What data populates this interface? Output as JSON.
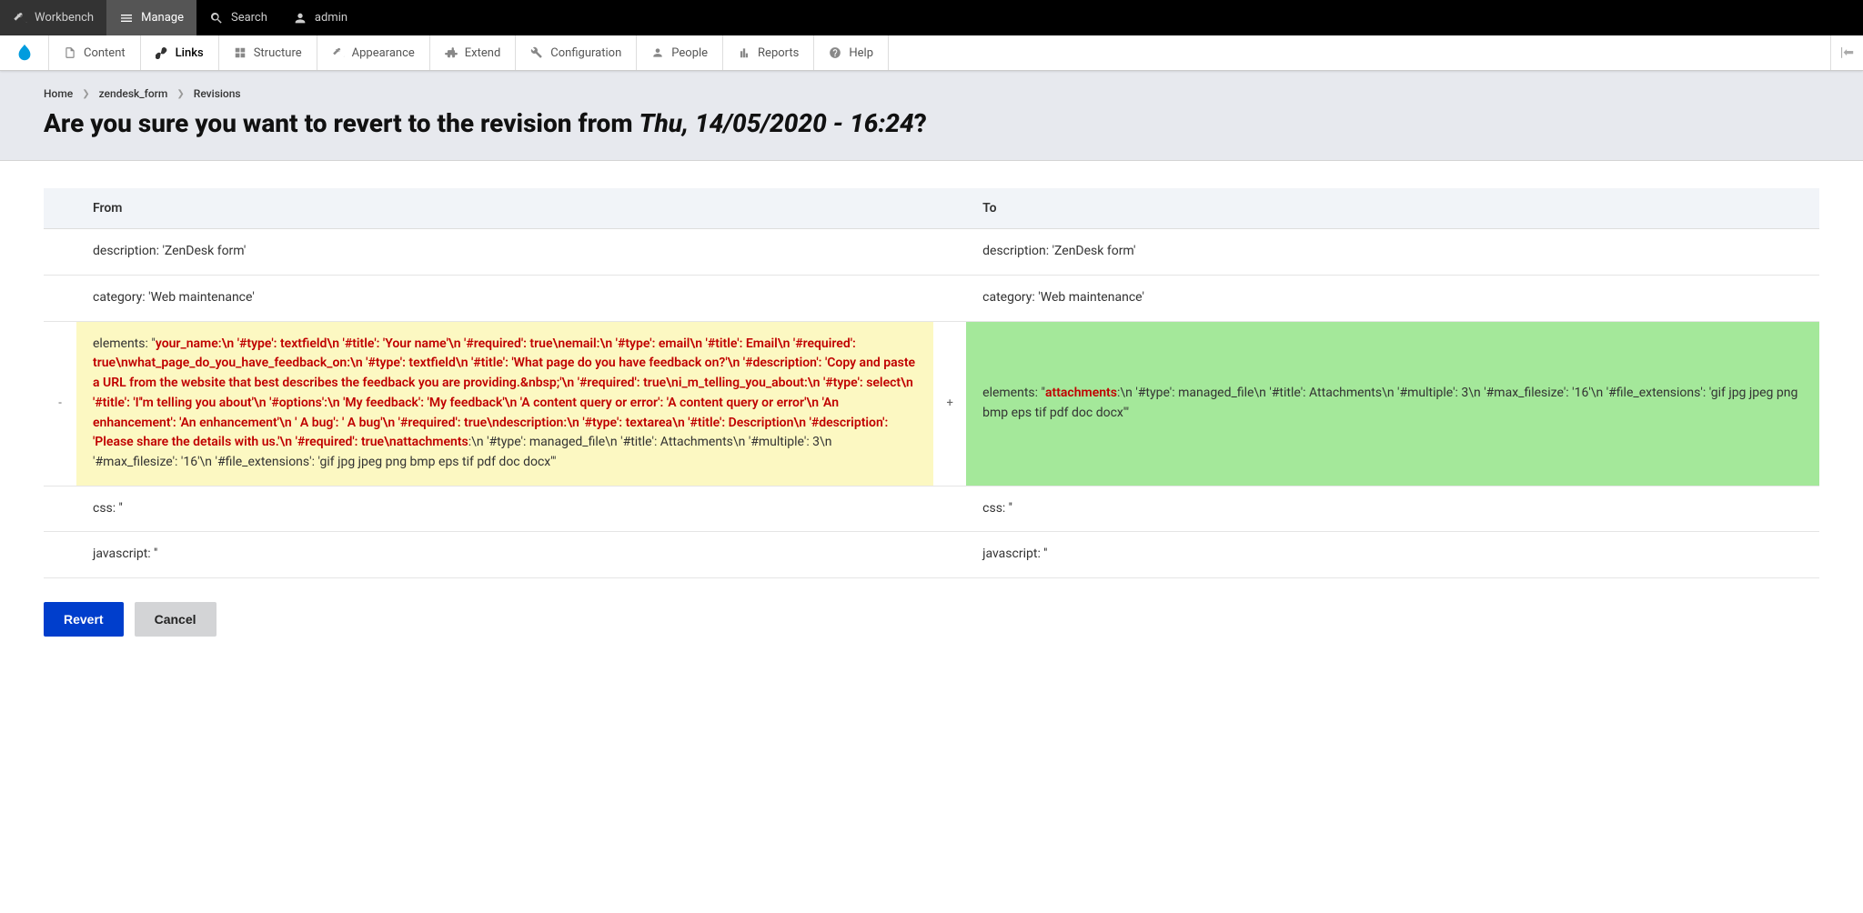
{
  "toolbar": {
    "workbench": "Workbench",
    "manage": "Manage",
    "search": "Search",
    "user": "admin"
  },
  "admin_menu": {
    "content": "Content",
    "links": "Links",
    "structure": "Structure",
    "appearance": "Appearance",
    "extend": "Extend",
    "configuration": "Configuration",
    "people": "People",
    "reports": "Reports",
    "help": "Help"
  },
  "breadcrumb": {
    "home": "Home",
    "form": "zendesk_form",
    "revisions": "Revisions"
  },
  "title": {
    "prefix": "Are you sure you want to revert to the revision from ",
    "date": "Thu, 14/05/2020 - 16:24",
    "suffix": "?"
  },
  "table": {
    "header_from": "From",
    "header_to": "To",
    "rows": {
      "description_from": "description: 'ZenDesk form'",
      "description_to": "description: 'ZenDesk form'",
      "category_from": "category: 'Web maintenance'",
      "category_to": "category: 'Web maintenance'",
      "elements_from_pre": "elements: \"",
      "elements_from_removed": "your_name:\\n '#type': textfield\\n '#title': 'Your name'\\n '#required': true\\nemail:\\n '#type': email\\n '#title': Email\\n '#required': true\\nwhat_page_do_you_have_feedback_on:\\n '#type': textfield\\n '#title': 'What page do you have feedback on?'\\n '#description': 'Copy and paste a URL from the website that best describes the feedback you are providing.&nbsp;'\\n '#required': true\\ni_m_telling_you_about:\\n '#type': select\\n '#title': 'I''m telling you about'\\n '#options':\\n 'My feedback': 'My feedback'\\n 'A content query or error': 'A content query or error'\\n 'An enhancement': 'An enhancement'\\n ' A bug': ' A bug'\\n '#required': true\\ndescription:\\n '#type': textarea\\n '#title': Description\\n '#description': 'Please share the details with us.'\\n '#required': true\\nattachments",
      "elements_from_post": ":\\n '#type': managed_file\\n '#title': Attachments\\n '#multiple': 3\\n '#max_filesize': '16'\\n '#file_extensions': 'gif jpg jpeg png bmp eps tif pdf doc docx'\"",
      "elements_to_pre": "elements: \"",
      "elements_to_added": "attachments",
      "elements_to_post": ":\\n '#type': managed_file\\n '#title': Attachments\\n '#multiple': 3\\n '#max_filesize': '16'\\n '#file_extensions': 'gif jpg jpeg png bmp eps tif pdf doc docx'\"",
      "css_from": "css: ''",
      "css_to": "css: ''",
      "js_from": "javascript: ''",
      "js_to": "javascript: ''"
    }
  },
  "buttons": {
    "revert": "Revert",
    "cancel": "Cancel"
  }
}
